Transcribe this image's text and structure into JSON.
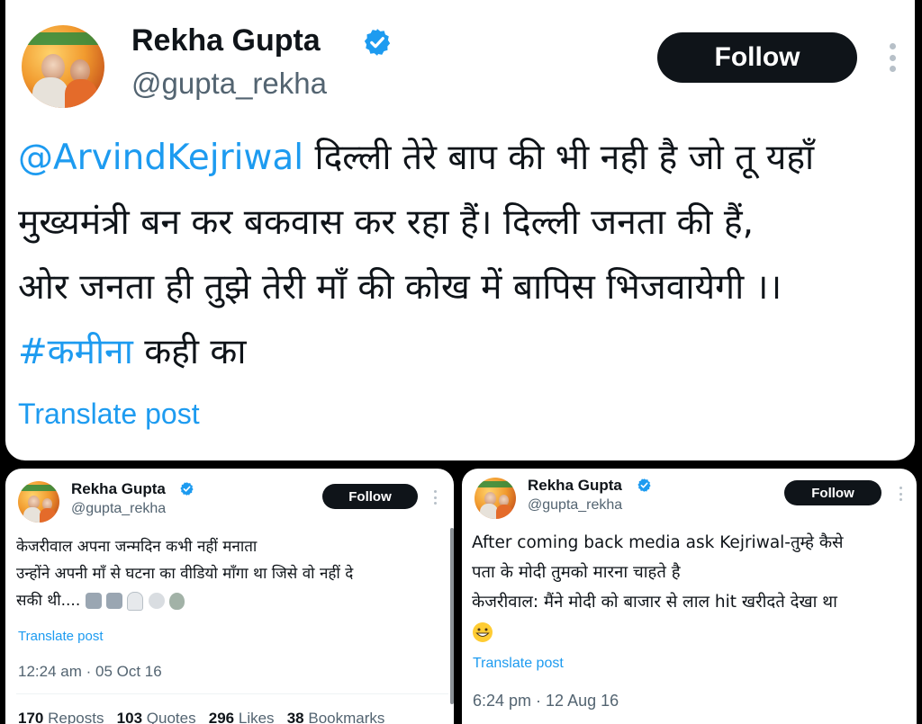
{
  "main": {
    "name": "Rekha Gupta",
    "handle": "@gupta_rekha",
    "follow_label": "Follow",
    "mention": "@ArvindKejriwal",
    "line1_rest": " दिल्ली तेरे बाप की भी नही है जो तू यहाँ",
    "line2": "मुख्यमंत्री बन कर बकवास कर रहा हैं। दिल्ली जनता की हैं,",
    "line3": "ओर जनता ही तुझे तेरी माँ की कोख में बापिस भिजवायेगी ।।",
    "hashtag": "#कमीना",
    "line4_rest": " कही का",
    "translate": "Translate post"
  },
  "left": {
    "name": "Rekha Gupta",
    "handle": "@gupta_rekha",
    "follow_label": "Follow",
    "line1": "केजरीवाल अपना जन्मदिन कभी नहीं मनाता",
    "line2": "उन्होंने अपनी माँ से घटना का वीडियो माँगा था जिसे वो नहीं दे",
    "line3": "सकी थी....",
    "emojis": [
      "robot-face-emoji",
      "robot-face-emoji",
      "ghost-emoji",
      "skull-emoji",
      "alien-emoji"
    ],
    "translate": "Translate post",
    "time": "12:24 am · 05 Oct 16",
    "stats": {
      "reposts_count": "170",
      "reposts_label": "Reposts",
      "quotes_count": "103",
      "quotes_label": "Quotes",
      "likes_count": "296",
      "likes_label": "Likes",
      "bookmarks_count": "38",
      "bookmarks_label": "Bookmarks"
    }
  },
  "right": {
    "name": "Rekha Gupta",
    "handle": "@gupta_rekha",
    "follow_label": "Follow",
    "line1": "After coming back media ask Kejriwal-तुम्हे कैसे",
    "line2": "पता के मोदी तुमको मारना चाहते है",
    "line3": "केजरीवाल: मैंने मोदी को बाजार से लाल hit खरीदते देखा था",
    "emoji": "grinning-face-emoji",
    "translate": "Translate post",
    "time": "6:24 pm · 12 Aug 16"
  },
  "colors": {
    "link": "#1d9bf0",
    "verified": "#1d9bf0",
    "button_bg": "#0f1419",
    "text": "#0f1419",
    "muted": "#536471"
  }
}
